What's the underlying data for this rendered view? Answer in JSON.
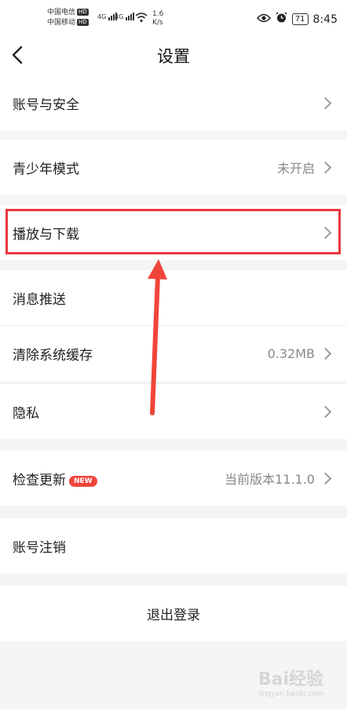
{
  "status_bar": {
    "carrier1": "中国电信",
    "carrier2": "中国移动",
    "hd": "HD",
    "net1": "4G",
    "net2": "4G",
    "speed_value": "1.6",
    "speed_unit": "K/s",
    "battery": "71",
    "time": "8:45"
  },
  "nav": {
    "title": "设置"
  },
  "settings": {
    "account_security": "账号与安全",
    "youth_mode": "青少年模式",
    "youth_mode_value": "未开启",
    "play_download": "播放与下载",
    "push": "消息推送",
    "clear_cache": "清除系统缓存",
    "cache_value": "0.32MB",
    "privacy": "隐私",
    "check_update": "检查更新",
    "new_badge": "NEW",
    "version_value": "当前版本11.1.0",
    "account_cancel": "账号注销",
    "logout": "退出登录"
  },
  "watermark": {
    "brand": "Bai经验",
    "url": "jingyan.baidu.com"
  },
  "colors": {
    "highlight": "#e8373e",
    "badge": "#f0463c"
  }
}
